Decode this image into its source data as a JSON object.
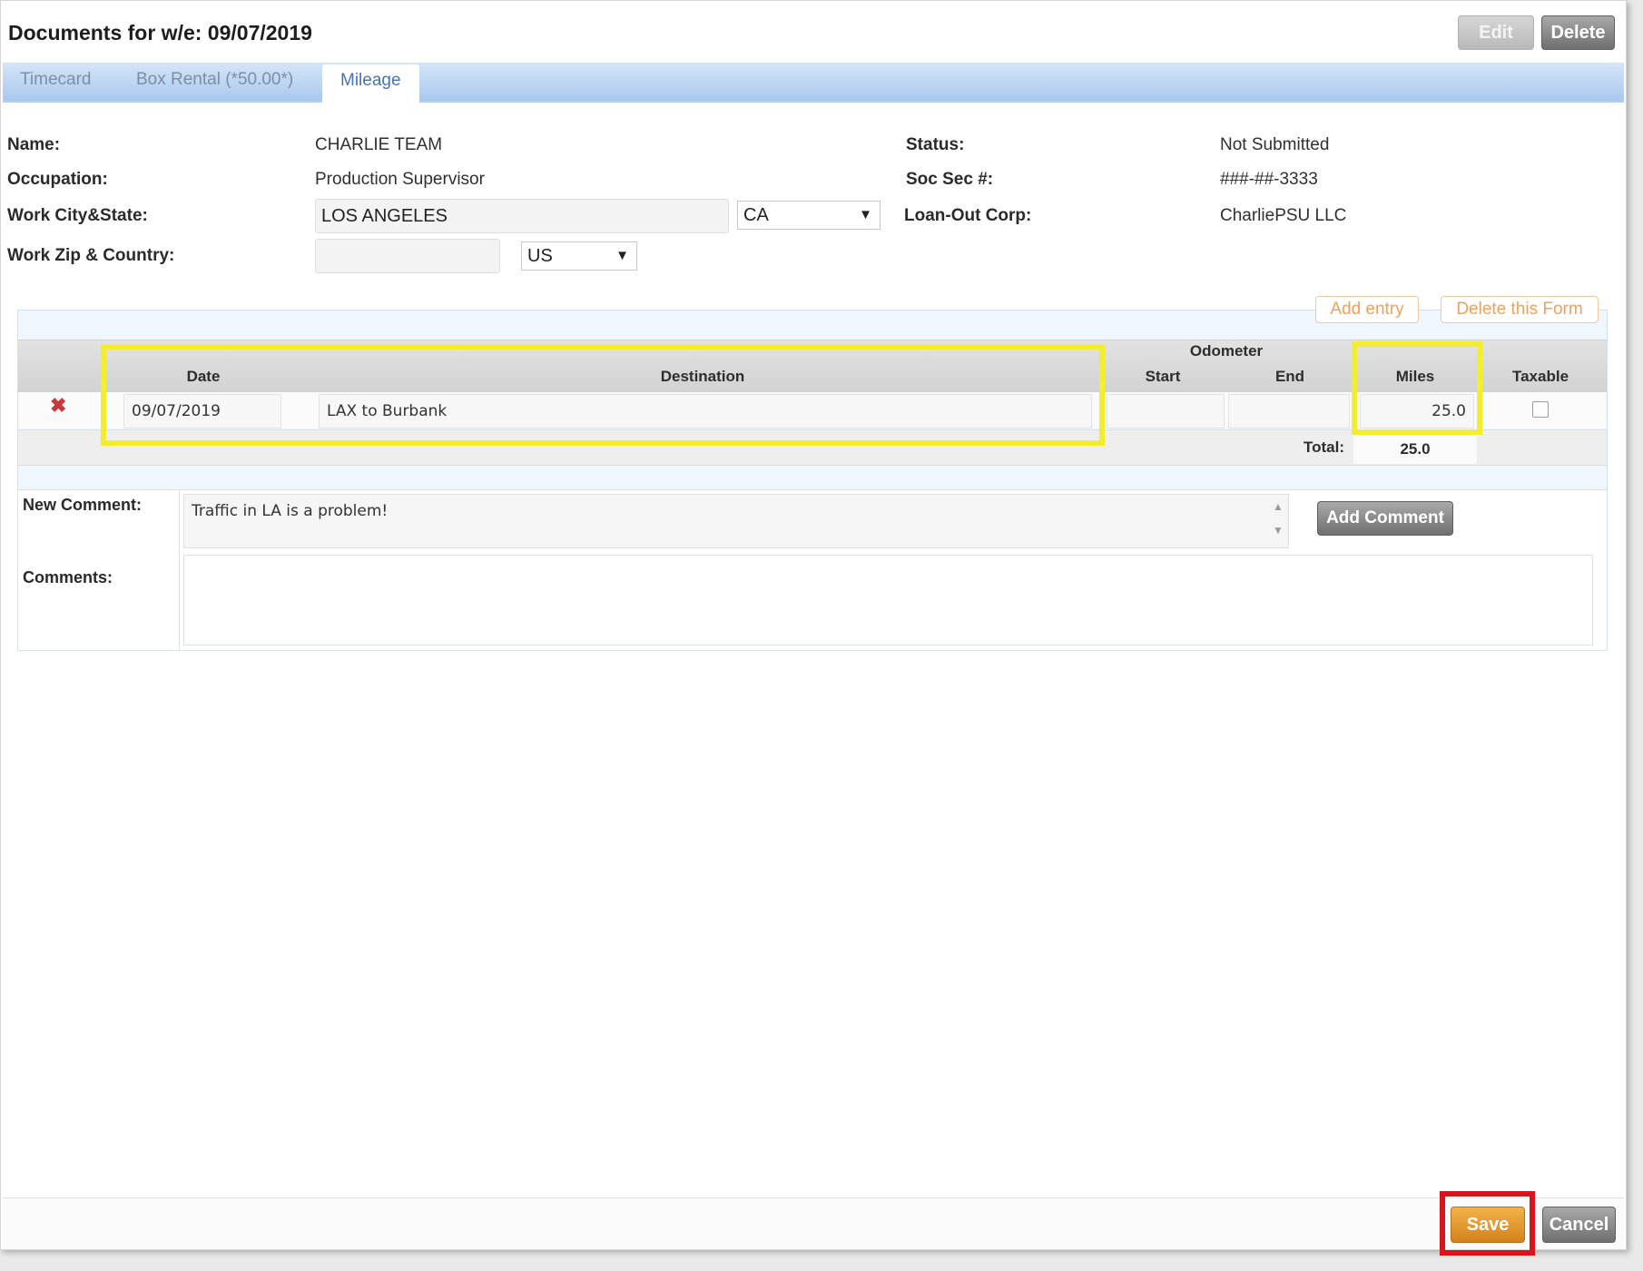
{
  "window": {
    "title": "Documents for w/e: 09/07/2019",
    "edit_label": "Edit",
    "delete_label": "Delete"
  },
  "tabs": [
    {
      "label": "Timecard"
    },
    {
      "label": "Box Rental (*50.00*)"
    },
    {
      "label": "Mileage",
      "active": true
    }
  ],
  "info": {
    "name_label": "Name:",
    "name": "CHARLIE TEAM",
    "occupation_label": "Occupation:",
    "occupation": "Production Supervisor",
    "work_city_label": "Work City&State:",
    "work_city": "LOS ANGELES",
    "work_state": "CA",
    "work_zip_label": "Work Zip & Country:",
    "work_zip": "",
    "work_country": "US",
    "status_label": "Status:",
    "status": "Not Submitted",
    "ssn_label": "Soc Sec #:",
    "ssn": "###-##-3333",
    "loanout_label": "Loan-Out Corp:",
    "loanout": "CharliePSU LLC"
  },
  "mileage": {
    "add_entry_label": "Add entry",
    "delete_form_label": "Delete this Form",
    "headers": {
      "date": "Date",
      "destination": "Destination",
      "odometer": "Odometer",
      "start": "Start",
      "end": "End",
      "miles": "Miles",
      "taxable": "Taxable"
    },
    "rows": [
      {
        "date": "09/07/2019",
        "destination": "LAX to Burbank",
        "start": "",
        "end": "",
        "miles": "25.0",
        "taxable": false
      }
    ],
    "total_label": "Total:",
    "total": "25.0"
  },
  "comments": {
    "new_label": "New Comment:",
    "new_value": "Traffic in LA is a problem!",
    "add_button": "Add Comment",
    "comments_label": "Comments:",
    "comments_value": ""
  },
  "footer": {
    "save_label": "Save",
    "cancel_label": "Cancel"
  },
  "icons": {
    "delete_row": "close-icon"
  },
  "colors": {
    "tab_bar": "#a9c8ee",
    "highlight": "#f4ec2e",
    "save_box": "#d9141b",
    "save_button": "#e19a32",
    "form_button_text": "#f0a25b"
  }
}
